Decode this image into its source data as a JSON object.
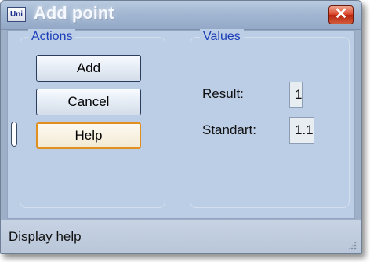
{
  "window": {
    "title": "Add point",
    "app_icon_label": "Uni",
    "close_glyph": "✕",
    "close_icon": "close-icon"
  },
  "actions": {
    "legend": "Actions",
    "add_label": "Add",
    "cancel_label": "Cancel",
    "help_label": "Help"
  },
  "values": {
    "legend": "Values",
    "result_label": "Result:",
    "result_value": "1",
    "standart_label": "Standart:",
    "standart_value": "1.1"
  },
  "status": {
    "text": "Display help"
  },
  "colors": {
    "legend_text": "#1b3eb8",
    "client_bg": "#bccde6",
    "help_focus_border": "#e1901f",
    "close_red": "#d9452a"
  }
}
